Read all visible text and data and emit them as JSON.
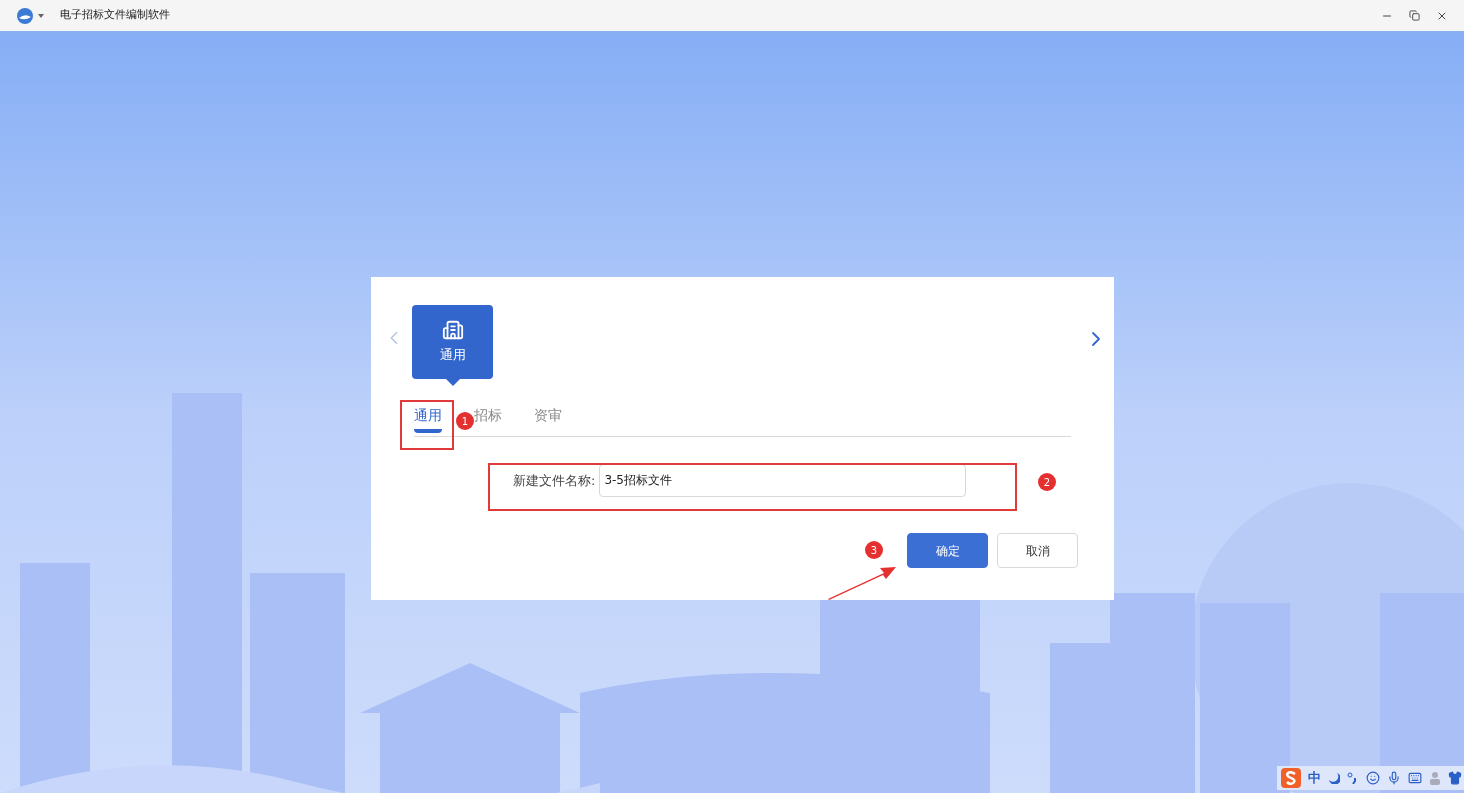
{
  "window": {
    "title": "电子招标文件编制软件"
  },
  "category_card": {
    "label": "通用",
    "selected": true
  },
  "tabs": [
    {
      "label": "通用",
      "selected": true
    },
    {
      "label": "招标",
      "selected": false
    },
    {
      "label": "资审",
      "selected": false
    }
  ],
  "form": {
    "label": "新建文件名称:",
    "value": "3-5招标文件"
  },
  "buttons": [
    {
      "label": "确定",
      "kind": "primary"
    },
    {
      "label": "取消",
      "kind": "default"
    }
  ],
  "annotations": [
    "1",
    "2",
    "3"
  ],
  "ime_bar": {
    "mode": "中"
  }
}
